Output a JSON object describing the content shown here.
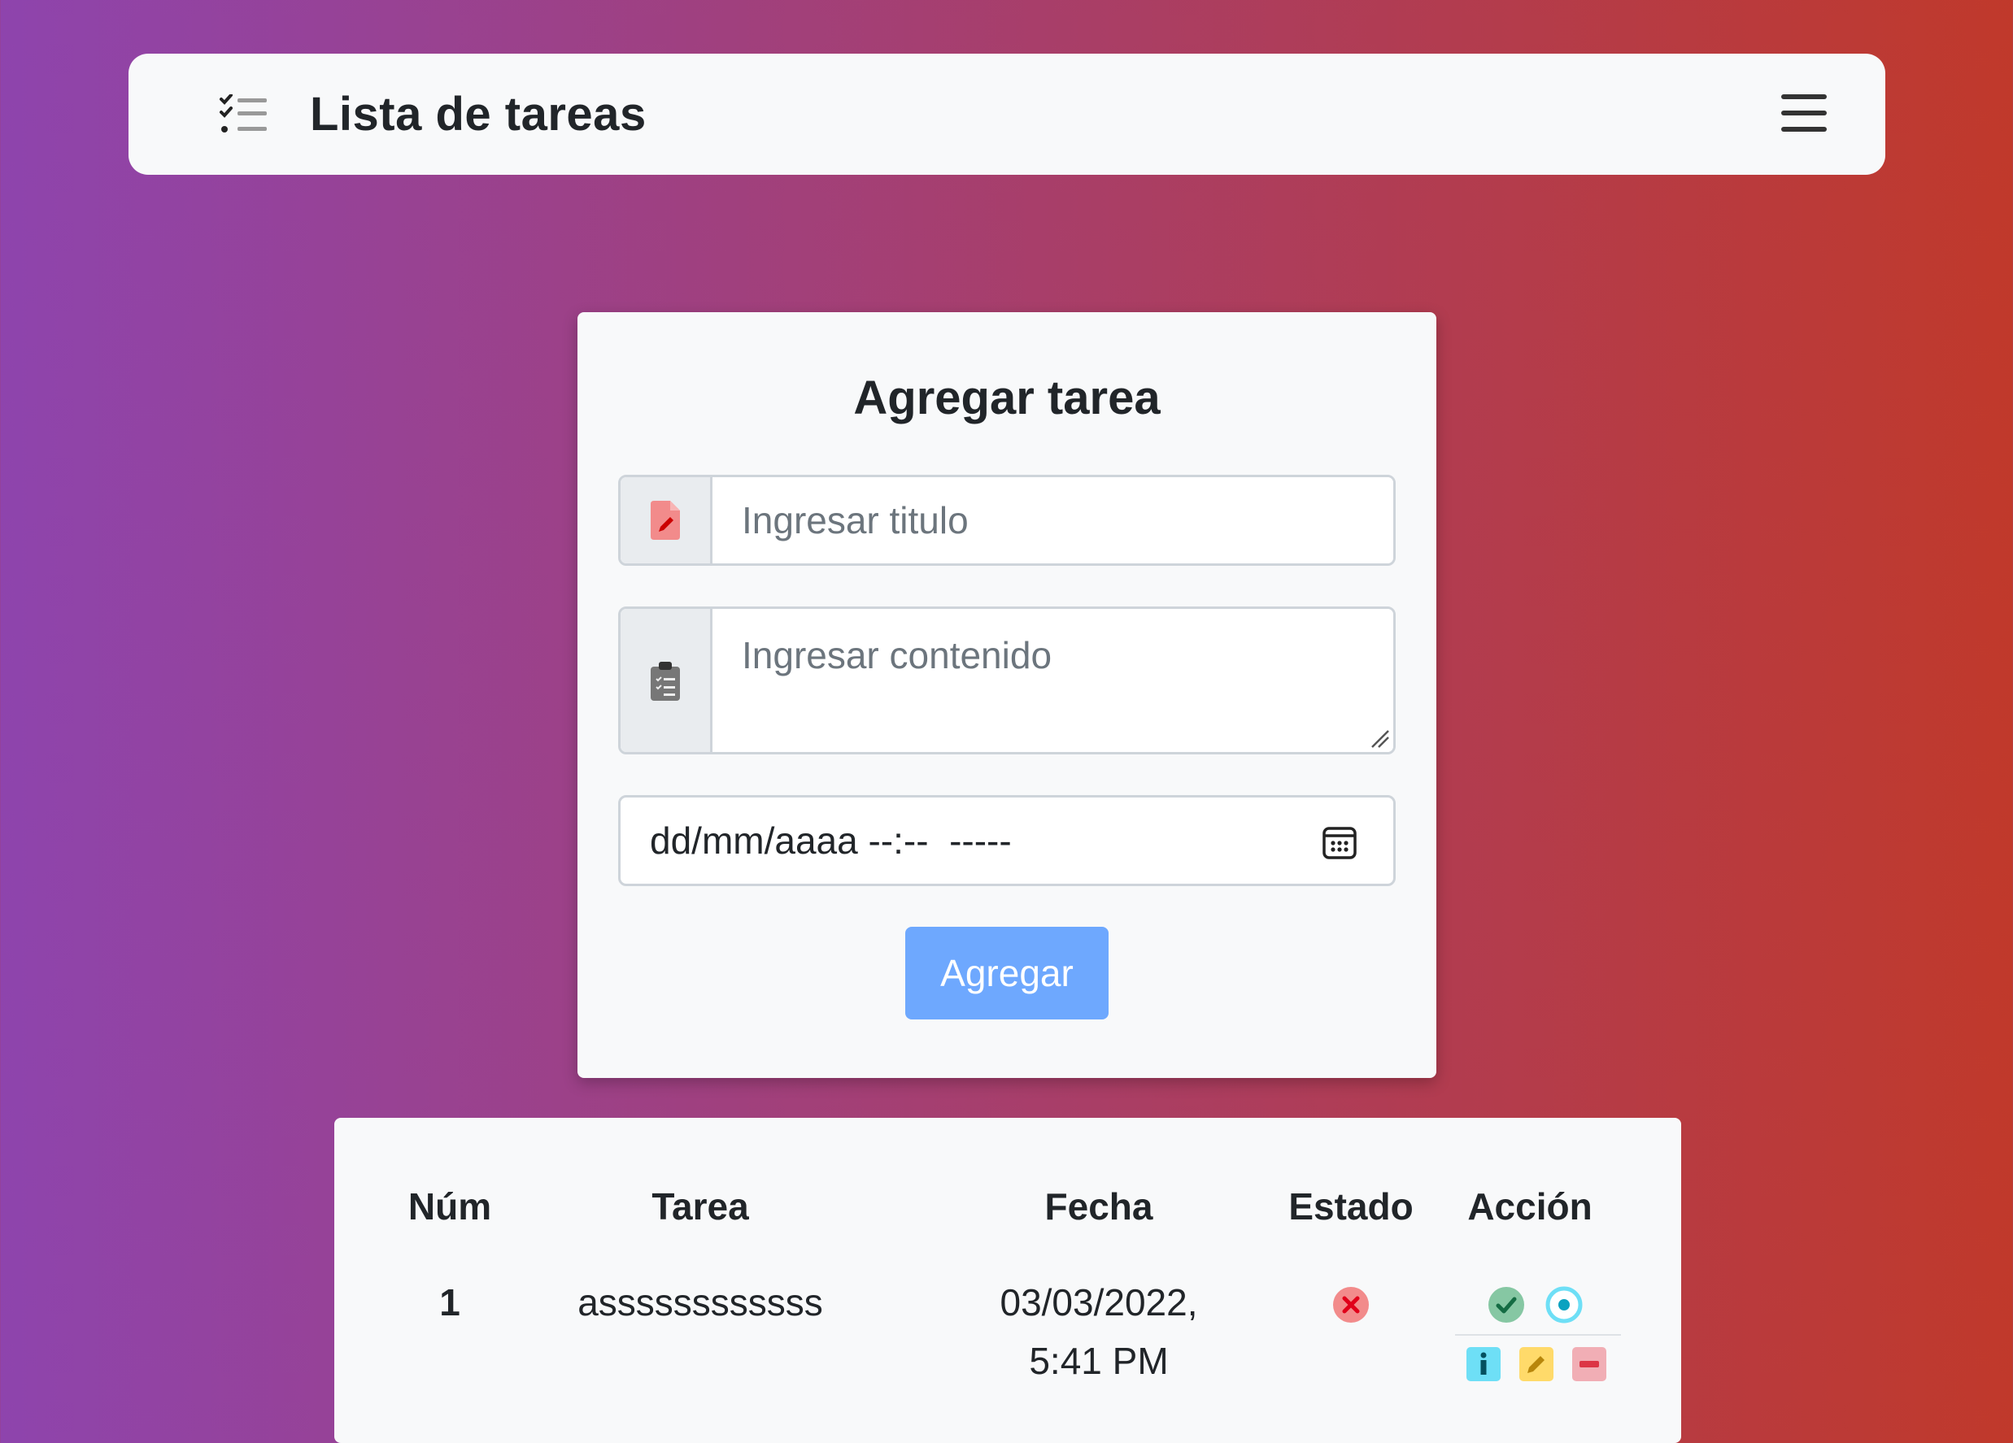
{
  "navbar": {
    "title": "Lista de tareas",
    "icon": "task-list-icon",
    "menu_icon": "hamburger-icon"
  },
  "form": {
    "title": "Agregar tarea",
    "title_placeholder": "Ingresar titulo",
    "content_placeholder": "Ingresar contenido",
    "title_icon": "file-edit-icon",
    "content_icon": "clipboard-list-icon",
    "date_placeholder": "dd/mm/aaaa --:--  -----",
    "calendar_icon": "calendar-icon",
    "submit_label": "Agregar"
  },
  "table": {
    "headers": [
      "Núm",
      "Tarea",
      "Fecha",
      "Estado",
      "Acción"
    ],
    "rows": [
      {
        "num": "1",
        "tarea": "assssssssssss",
        "fecha_line1": "03/03/2022,",
        "fecha_line2": "5:41 PM",
        "estado_icon": "x-circle-icon",
        "acciones": [
          "check-circle-icon",
          "record-circle-icon",
          "info-square-icon",
          "pencil-square-icon",
          "dash-square-icon"
        ]
      }
    ]
  },
  "colors": {
    "gradient_start": "#8e44ad",
    "gradient_end": "#c0392b",
    "primary_button": "#6ea8fe",
    "danger": "#dc3545",
    "success": "#198754",
    "info": "#0dcaf0",
    "warning": "#ffc107"
  }
}
